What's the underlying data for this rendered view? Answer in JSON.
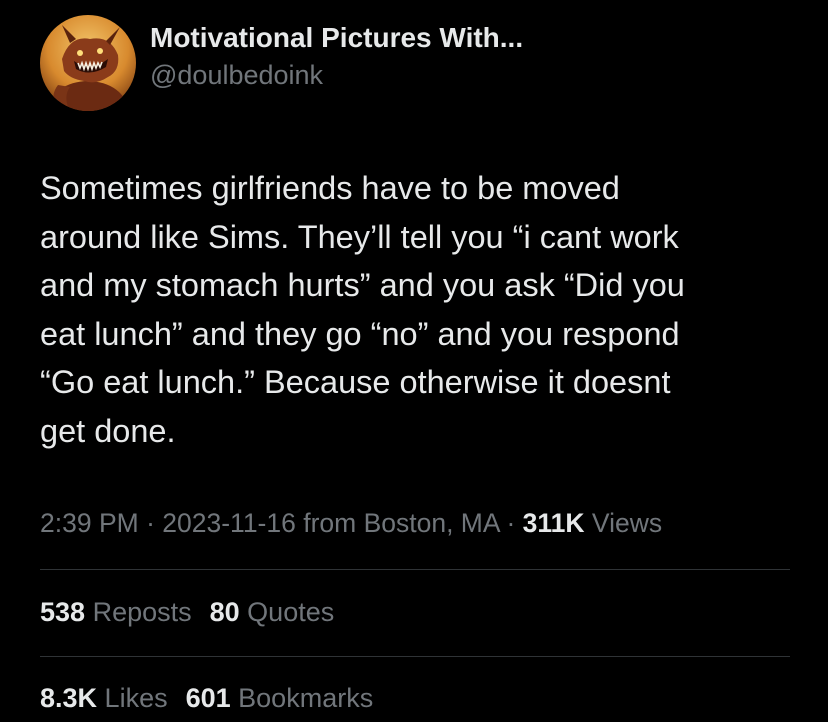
{
  "author": {
    "display_name": "Motivational Pictures With...",
    "handle": "@doulbedoink",
    "avatar_icon": "demon-avatar"
  },
  "tweet": {
    "text": "Sometimes girlfriends have to be moved\naround like Sims. They’ll tell you “i cant work\nand my stomach hurts” and you ask “Did you\neat lunch” and they go “no” and you respond\n“Go eat lunch.” Because otherwise it doesnt\nget done."
  },
  "meta": {
    "time": "2:39 PM",
    "sep1": " · ",
    "date": "2023-11-16",
    "location": " from Boston, MA",
    "sep2": " · ",
    "views_count": "311K",
    "views_label": " Views"
  },
  "stats_row1": {
    "reposts_count": "538",
    "reposts_label": " Reposts",
    "quotes_count": "80",
    "quotes_label": " Quotes"
  },
  "stats_row2": {
    "likes_count": "8.3K",
    "likes_label": " Likes",
    "bookmarks_count": "601",
    "bookmarks_label": " Bookmarks"
  },
  "colors": {
    "background": "#000000",
    "primary_text": "#e7e9ea",
    "secondary_text": "#71767b",
    "divider": "#2f3336"
  }
}
